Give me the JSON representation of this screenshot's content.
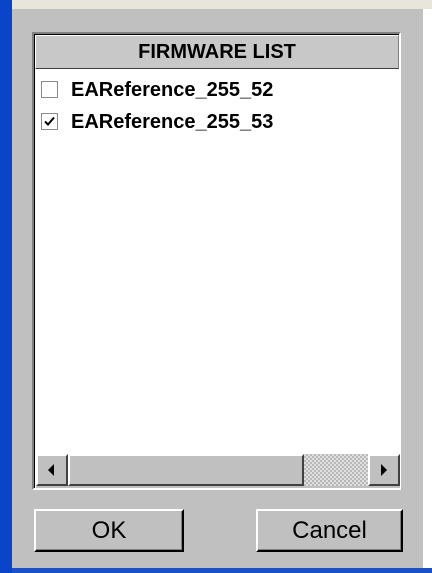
{
  "dialog": {
    "list_header": "FIRMWARE LIST",
    "items": [
      {
        "label": "EAReference_255_52",
        "checked": false
      },
      {
        "label": "EAReference_255_53",
        "checked": true
      }
    ],
    "ok_label": "OK",
    "cancel_label": "Cancel"
  },
  "colors": {
    "dialog_bg": "#c0c0c0",
    "window_frame": "#0a44c8",
    "list_bg": "#ffffff"
  }
}
